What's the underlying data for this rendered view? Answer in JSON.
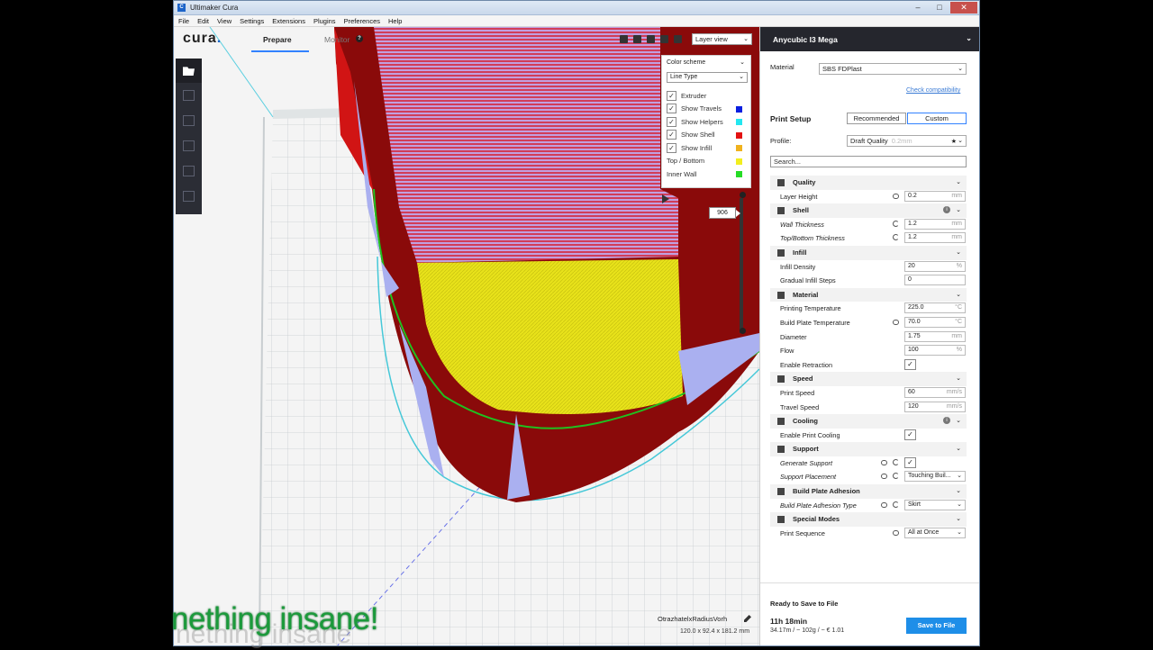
{
  "window": {
    "title": "Ultimaker Cura",
    "app_icon": "C"
  },
  "menu": [
    "File",
    "Edit",
    "View",
    "Settings",
    "Extensions",
    "Plugins",
    "Preferences",
    "Help"
  ],
  "header": {
    "logo": "cura",
    "logo_dot": ".",
    "stages": {
      "prepare": "Prepare",
      "monitor": "Monitor"
    },
    "view_mode": "Layer view"
  },
  "legend": {
    "color_scheme": "Color scheme",
    "line_type": "Line Type",
    "items": [
      {
        "label": "Extruder",
        "checked": true,
        "color": ""
      },
      {
        "label": "Show Travels",
        "checked": true,
        "color": "#0a1fe0"
      },
      {
        "label": "Show Helpers",
        "checked": true,
        "color": "#23e7f0"
      },
      {
        "label": "Show Shell",
        "checked": true,
        "color": "#e31212"
      },
      {
        "label": "Show Infill",
        "checked": true,
        "color": "#f0b21e"
      }
    ],
    "plain_items": [
      {
        "label": "Top / Bottom",
        "color": "#f2ee1e"
      },
      {
        "label": "Inner Wall",
        "color": "#25dc25"
      }
    ]
  },
  "layer_slider": {
    "current": "906"
  },
  "model": {
    "name": "OtrazhatelxRadiusVorh",
    "dimensions": "120.0 x 92.4 x 181.2 mm"
  },
  "sidebar": {
    "printer": "Anycubic I3 Mega",
    "material_label": "Material",
    "material": "SBS FDPlast",
    "check_compat": "Check compatibility",
    "print_setup": "Print Setup",
    "mode_recommended": "Recommended",
    "mode_custom": "Custom",
    "profile_label": "Profile:",
    "profile": "Draft Quality",
    "profile_sub": "0.2mm",
    "search_placeholder": "Search...",
    "categories": {
      "quality": "Quality",
      "shell": "Shell",
      "infill": "Infill",
      "material": "Material",
      "speed": "Speed",
      "cooling": "Cooling",
      "support": "Support",
      "adhesion": "Build Plate Adhesion",
      "special": "Special Modes"
    },
    "settings": {
      "layer_height": {
        "label": "Layer Height",
        "value": "0.2",
        "unit": "mm"
      },
      "wall_thickness": {
        "label": "Wall Thickness",
        "value": "1.2",
        "unit": "mm"
      },
      "topbottom_thickness": {
        "label": "Top/Bottom Thickness",
        "value": "1.2",
        "unit": "mm"
      },
      "infill_density": {
        "label": "Infill Density",
        "value": "20",
        "unit": "%"
      },
      "gradual_infill": {
        "label": "Gradual Infill Steps",
        "value": "0",
        "unit": ""
      },
      "print_temp": {
        "label": "Printing Temperature",
        "value": "225.0",
        "unit": "°C"
      },
      "bed_temp": {
        "label": "Build Plate Temperature",
        "value": "70.0",
        "unit": "°C"
      },
      "diameter": {
        "label": "Diameter",
        "value": "1.75",
        "unit": "mm"
      },
      "flow": {
        "label": "Flow",
        "value": "100",
        "unit": "%"
      },
      "retraction": {
        "label": "Enable Retraction",
        "checked": true
      },
      "print_speed": {
        "label": "Print Speed",
        "value": "60",
        "unit": "mm/s"
      },
      "travel_speed": {
        "label": "Travel Speed",
        "value": "120",
        "unit": "mm/s"
      },
      "print_cooling": {
        "label": "Enable Print Cooling",
        "checked": true
      },
      "generate_support": {
        "label": "Generate Support",
        "checked": true
      },
      "support_placement": {
        "label": "Support Placement",
        "value": "Touching Buil..."
      },
      "adhesion_type": {
        "label": "Build Plate Adhesion Type",
        "value": "Skirt"
      },
      "print_sequence": {
        "label": "Print Sequence",
        "value": "All at Once"
      }
    },
    "ready": "Ready to Save to File",
    "time": "11h 18min",
    "cost": "34.17m / ~ 102g / ~ € 1.01",
    "save_button": "Save to File"
  },
  "overlay": {
    "caption": "nething insane!",
    "ghost": "nething insane"
  },
  "colors": {
    "accent": "#3282ff",
    "save": "#1e8ee8",
    "shell": "#e01010",
    "infill": "#f0ee10",
    "travel": "#b0a8ff"
  }
}
